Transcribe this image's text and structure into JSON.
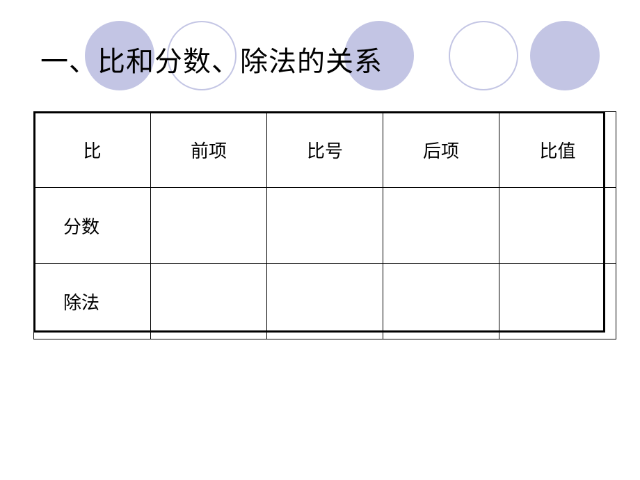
{
  "slide": {
    "title": "一、比和分数、除法的关系",
    "background_color": "#ffffff",
    "accent_color": "#c3c5e4"
  },
  "decorations": [
    {
      "name": "circle-filled-1",
      "style": "filled"
    },
    {
      "name": "circle-outline-1",
      "style": "outline"
    },
    {
      "name": "circle-filled-2",
      "style": "filled"
    },
    {
      "name": "circle-outline-2",
      "style": "outline"
    },
    {
      "name": "circle-filled-3",
      "style": "filled"
    }
  ],
  "table": {
    "headers": [
      "比",
      "前项",
      "比号",
      "后项",
      "比值"
    ],
    "rows": [
      {
        "label": "分数",
        "cells": [
          "",
          "",
          "",
          ""
        ]
      },
      {
        "label": "除法",
        "cells": [
          "",
          "",
          "",
          ""
        ]
      }
    ]
  }
}
